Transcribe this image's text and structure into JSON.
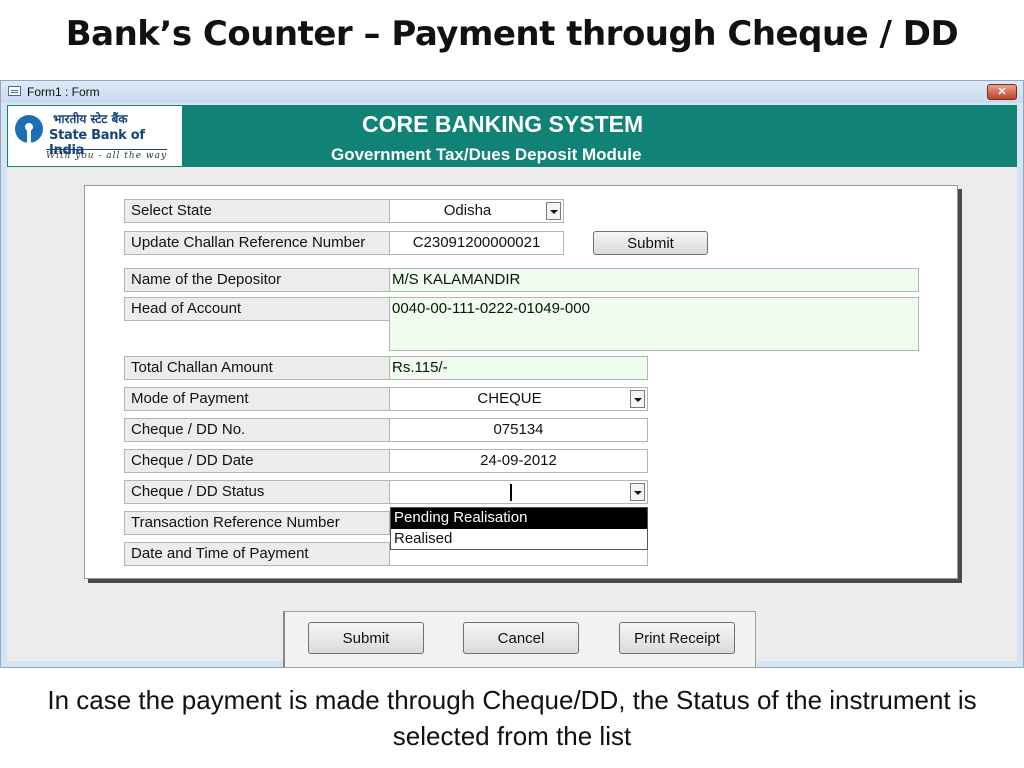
{
  "slide": {
    "title": "Bank’s Counter – Payment  through Cheque / DD",
    "caption": "In case the payment is made through Cheque/DD, the Status of the instrument is selected from the list"
  },
  "window": {
    "title": "Form1 : Form",
    "close_label": "✕"
  },
  "banner": {
    "logo_hindi": "भारतीय स्टेट बैंक",
    "logo_name": "State Bank of India",
    "logo_tagline": "With you - all the way",
    "system_title": "CORE BANKING SYSTEM",
    "module_title": "Government Tax/Dues Deposit Module"
  },
  "form": {
    "state": {
      "label": "Select State",
      "value": "Odisha"
    },
    "challan_ref": {
      "label": "Update Challan Reference Number",
      "value": "C23091200000021",
      "submit_label": "Submit"
    },
    "depositor": {
      "label": "Name of the Depositor",
      "value": "M/S KALAMANDIR"
    },
    "head_of_account": {
      "label": "Head of Account",
      "value": "0040-00-111-0222-01049-000"
    },
    "total_amount": {
      "label": "Total Challan Amount",
      "value": "Rs.115/-"
    },
    "mode": {
      "label": "Mode of Payment",
      "value": "CHEQUE"
    },
    "cheque_no": {
      "label": "Cheque / DD No.",
      "value": "075134"
    },
    "cheque_date": {
      "label": "Cheque / DD Date",
      "value": "24-09-2012"
    },
    "cheque_status": {
      "label": "Cheque / DD Status",
      "value": "",
      "options": [
        "Pending Realisation",
        "Realised"
      ],
      "highlighted": "Pending Realisation"
    },
    "txn_ref": {
      "label": "Transaction Reference Number",
      "value": ""
    },
    "payment_datetime": {
      "label": "Date and Time of Payment",
      "value": ""
    }
  },
  "actions": {
    "submit": "Submit",
    "cancel": "Cancel",
    "print": "Print Receipt"
  },
  "colors": {
    "banner": "#118376",
    "window_frame": "#d6e4f2",
    "readonly_field": "#eefded"
  }
}
